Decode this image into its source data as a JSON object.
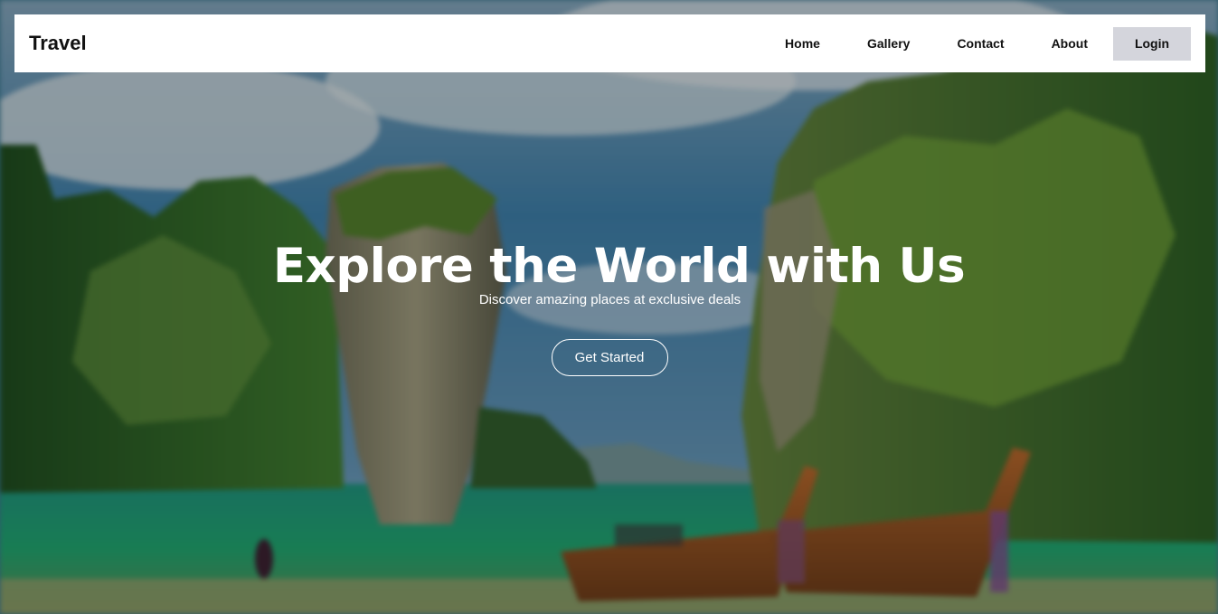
{
  "brand": {
    "logo": "Travel"
  },
  "nav": {
    "items": [
      {
        "label": "Home"
      },
      {
        "label": "Gallery"
      },
      {
        "label": "Contact"
      },
      {
        "label": "About"
      }
    ],
    "login_label": "Login"
  },
  "hero": {
    "title": "Explore the World with Us",
    "subtitle": "Discover amazing places at exclusive deals",
    "cta_label": "Get Started",
    "background_image": "tropical-beach-limestone-cliffs-longtail-boats"
  },
  "colors": {
    "navbar_bg": "#ffffff",
    "login_bg": "#d4d5dc",
    "text_dark": "#111111",
    "hero_text": "#ffffff"
  }
}
